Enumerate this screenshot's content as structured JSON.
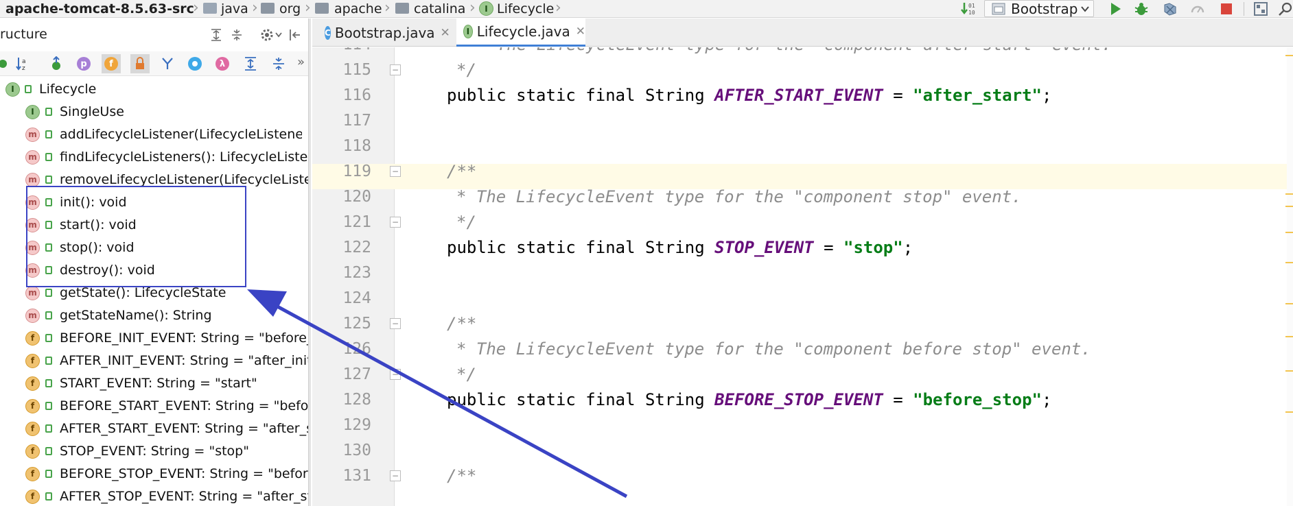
{
  "breadcrumbs": [
    "apache-tomcat-8.5.63-src",
    "java",
    "org",
    "apache",
    "catalina",
    "Lifecycle"
  ],
  "run_config": "Bootstrap",
  "structure": {
    "title": "ructure",
    "tree": [
      {
        "label": "Lifecycle",
        "kind": "interface"
      },
      {
        "label": "SingleUse",
        "kind": "interface"
      },
      {
        "label": "addLifecycleListener(LifecycleListener):",
        "kind": "method"
      },
      {
        "label": "findLifecycleListeners(): LifecycleListene",
        "kind": "method"
      },
      {
        "label": "removeLifecycleListener(LifecycleListen",
        "kind": "method"
      },
      {
        "label": "init(): void",
        "kind": "method"
      },
      {
        "label": "start(): void",
        "kind": "method"
      },
      {
        "label": "stop(): void",
        "kind": "method"
      },
      {
        "label": "destroy(): void",
        "kind": "method"
      },
      {
        "label": "getState(): LifecycleState",
        "kind": "method"
      },
      {
        "label": "getStateName(): String",
        "kind": "method"
      },
      {
        "label": "BEFORE_INIT_EVENT: String = \"before_",
        "kind": "field"
      },
      {
        "label": "AFTER_INIT_EVENT: String = \"after_init",
        "kind": "field"
      },
      {
        "label": "START_EVENT: String = \"start\"",
        "kind": "field"
      },
      {
        "label": "BEFORE_START_EVENT: String = \"befo",
        "kind": "field"
      },
      {
        "label": "AFTER_START_EVENT: String = \"after_s",
        "kind": "field"
      },
      {
        "label": "STOP_EVENT: String = \"stop\"",
        "kind": "field"
      },
      {
        "label": "BEFORE_STOP_EVENT: String = \"befor",
        "kind": "field"
      },
      {
        "label": "AFTER_STOP_EVENT: String = \"after_st",
        "kind": "field"
      }
    ]
  },
  "tabs": [
    {
      "label": "Bootstrap.java",
      "icon": "C",
      "active": false
    },
    {
      "label": "Lifecycle.java",
      "icon": "I",
      "active": true
    }
  ],
  "editor": {
    "partial_top": "* The LifecycleEvent type for the \"component after start\" event.",
    "lines": [
      {
        "num": "114",
        "text": ""
      },
      {
        "num": "115",
        "text": "*/"
      },
      {
        "num": "116",
        "text": "public static final String AFTER_START_EVENT = \"after_start\";"
      },
      {
        "num": "117",
        "text": ""
      },
      {
        "num": "118",
        "text": ""
      },
      {
        "num": "119",
        "text": "/**"
      },
      {
        "num": "120",
        "text": "* The LifecycleEvent type for the \"component stop\" event."
      },
      {
        "num": "121",
        "text": "*/"
      },
      {
        "num": "122",
        "text": "public static final String STOP_EVENT = \"stop\";"
      },
      {
        "num": "123",
        "text": ""
      },
      {
        "num": "124",
        "text": ""
      },
      {
        "num": "125",
        "text": "/**"
      },
      {
        "num": "126",
        "text": "* The LifecycleEvent type for the \"component before stop\" event."
      },
      {
        "num": "127",
        "text": "*/"
      },
      {
        "num": "128",
        "text": "public static final String BEFORE_STOP_EVENT = \"before_stop\";"
      },
      {
        "num": "129",
        "text": ""
      },
      {
        "num": "130",
        "text": ""
      },
      {
        "num": "131",
        "text": "/**"
      }
    ],
    "code": {
      "kw": "public static final String ",
      "c1": "AFTER_START_EVENT",
      "v1": "\"after_start\"",
      "c2": "STOP_EVENT",
      "v2": "\"stop\"",
      "c3": "BEFORE_STOP_EVENT",
      "v3": "\"before_stop\"",
      "eq": " = ",
      "semi": ";",
      "doc_open": "/**",
      "doc_close": "*/",
      "doc120": "* The LifecycleEvent type for the \"component stop\" event.",
      "doc126": "* The LifecycleEvent type for the \"component before stop\" event."
    }
  },
  "colors": {
    "annotation": "#3a43c4",
    "constant": "#660e7a",
    "string": "#067d17"
  }
}
